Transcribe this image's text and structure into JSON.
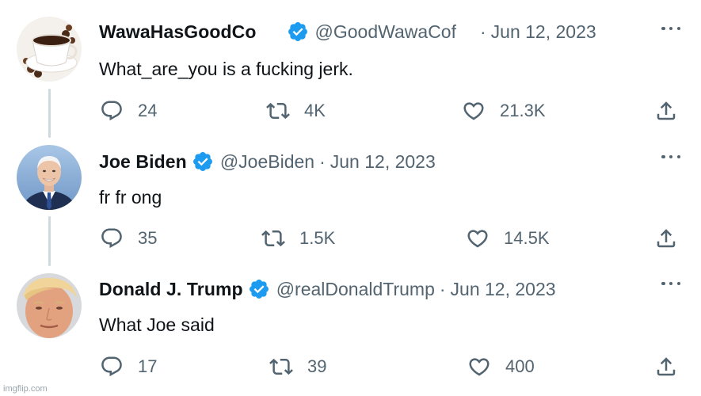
{
  "tweets": [
    {
      "display_name": "WawaHasGoodCo",
      "handle": "@GoodWawaCof",
      "separator": "·",
      "date": "Jun 12, 2023",
      "text": "What_are_you is a fucking jerk.",
      "avatar_icon": "coffee-cup-avatar",
      "verified": true,
      "actions": {
        "replies": "24",
        "retweets": "4K",
        "likes": "21.3K"
      }
    },
    {
      "display_name": "Joe Biden",
      "handle": "@JoeBiden",
      "separator": "·",
      "date": "Jun 12, 2023",
      "text": "fr fr ong",
      "avatar_icon": "joe-biden-avatar",
      "verified": true,
      "actions": {
        "replies": "35",
        "retweets": "1.5K",
        "likes": "14.5K"
      }
    },
    {
      "display_name": "Donald J. Trump",
      "handle": "@realDonaldTrump",
      "separator": "·",
      "date": "Jun 12, 2023",
      "text": "What Joe said",
      "avatar_icon": "donald-trump-avatar",
      "verified": true,
      "actions": {
        "replies": "17",
        "retweets": "39",
        "likes": "400"
      }
    }
  ],
  "watermark": "imgflip.com",
  "colors": {
    "verified_blue": "#1d9bf0",
    "secondary_text": "#536471",
    "primary_text": "#0f1419",
    "thread_line": "#cfd9de"
  }
}
